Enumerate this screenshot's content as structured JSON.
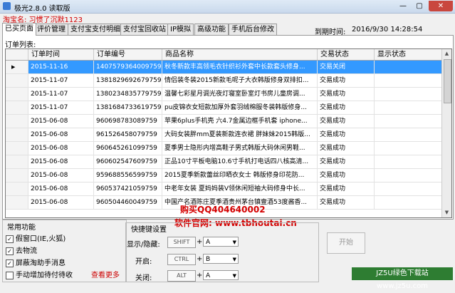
{
  "window": {
    "title": "极光2.8.0 读取版",
    "min": "—",
    "max": "▢",
    "close": "✕"
  },
  "taobao": {
    "label": "淘宝名: 习惯了沉默1123"
  },
  "tabs": [
    "已买页面",
    "评价管理",
    "支付宝支付明细",
    "支付宝回收站",
    "IP模拟",
    "高级功能",
    "手机后台修改"
  ],
  "expire": {
    "label": "到期时间:",
    "value": "2016/9/30 14:28:54"
  },
  "orders": {
    "label": "订单列表:",
    "columns": [
      "订单时间",
      "订单编号",
      "商品名称",
      "交易状态",
      "显示状态"
    ],
    "rows": [
      {
        "date": "2015-11-16",
        "id": "1407579364009759",
        "name": "秋冬新款丰高领毛衣针织衫外套中长款套头修身...",
        "status": "交易关闭",
        "show": ""
      },
      {
        "date": "2015-11-07",
        "id": "1381829692679759",
        "name": "情侣装冬装2015新款毛呢子大衣韩版修身双排扣...",
        "status": "交易成功",
        "show": ""
      },
      {
        "date": "2015-11-07",
        "id": "1380234835779759",
        "name": "温馨七彩星月调光夜灯寝室卧室灯书房儿童房调...",
        "status": "交易成功",
        "show": ""
      },
      {
        "date": "2015-11-07",
        "id": "1381684733619759",
        "name": "pu皮锦衣女短款加厚外套羽绒棉服冬装韩版修身...",
        "status": "交易成功",
        "show": ""
      },
      {
        "date": "2015-06-08",
        "id": "960698783089759",
        "name": "苹果6plus手机壳 六4.7金属边框手机套 iphone...",
        "status": "交易成功",
        "show": ""
      },
      {
        "date": "2015-06-08",
        "id": "961526458079759",
        "name": "大码女装胖mm夏装新款连衣裙 胖妹妹2015韩版...",
        "status": "交易成功",
        "show": ""
      },
      {
        "date": "2015-06-08",
        "id": "960645261099759",
        "name": "夏季男士隐形内增高鞋子男式韩版大码休闲男鞋...",
        "status": "交易成功",
        "show": ""
      },
      {
        "date": "2015-06-08",
        "id": "960602547609759",
        "name": "正品10寸平板电脑10.6寸手机打电话四八核高清...",
        "status": "交易成功",
        "show": ""
      },
      {
        "date": "2015-06-08",
        "id": "959688556599759",
        "name": "2015夏季新款蕾丝印晒衣女士 韩版修身印花防...",
        "status": "交易成功",
        "show": ""
      },
      {
        "date": "2015-06-08",
        "id": "960537421059759",
        "name": "中老年女装 夏妈妈装V领休闲短袖大码修身中长...",
        "status": "交易成功",
        "show": ""
      },
      {
        "date": "2015-06-08",
        "id": "960504460049759",
        "name": "中国产名酒陈庄夏季酒贵州茅台镇壹酒53度酱香...",
        "status": "交易成功",
        "show": ""
      }
    ]
  },
  "options": {
    "title": "常用功能",
    "items": [
      {
        "label": "假窗口(IE,火狐)",
        "checked": true
      },
      {
        "label": "去物流",
        "checked": true
      },
      {
        "label": "屏蔽淘助手消息",
        "checked": true
      },
      {
        "label": "手动增加待付待收",
        "checked": false
      }
    ],
    "more": "查看更多"
  },
  "hotkeys": {
    "title": "快捷键设置",
    "show_label": "显示/隐藏:",
    "show_mod": "SHIFT",
    "show_key": "A",
    "start_label": "开启:",
    "start_mod": "CTRL",
    "start_key": "B",
    "close_label": "关闭:",
    "close_mod": "ALT",
    "close_key": "A",
    "plus": "+"
  },
  "start_button": "开始",
  "promo": {
    "line1": "购买QQ404640002",
    "line2": "软件官网: www.tbhoutai.cn"
  },
  "watermark": "JZ5U绿色下载站 www.jz5u.com"
}
